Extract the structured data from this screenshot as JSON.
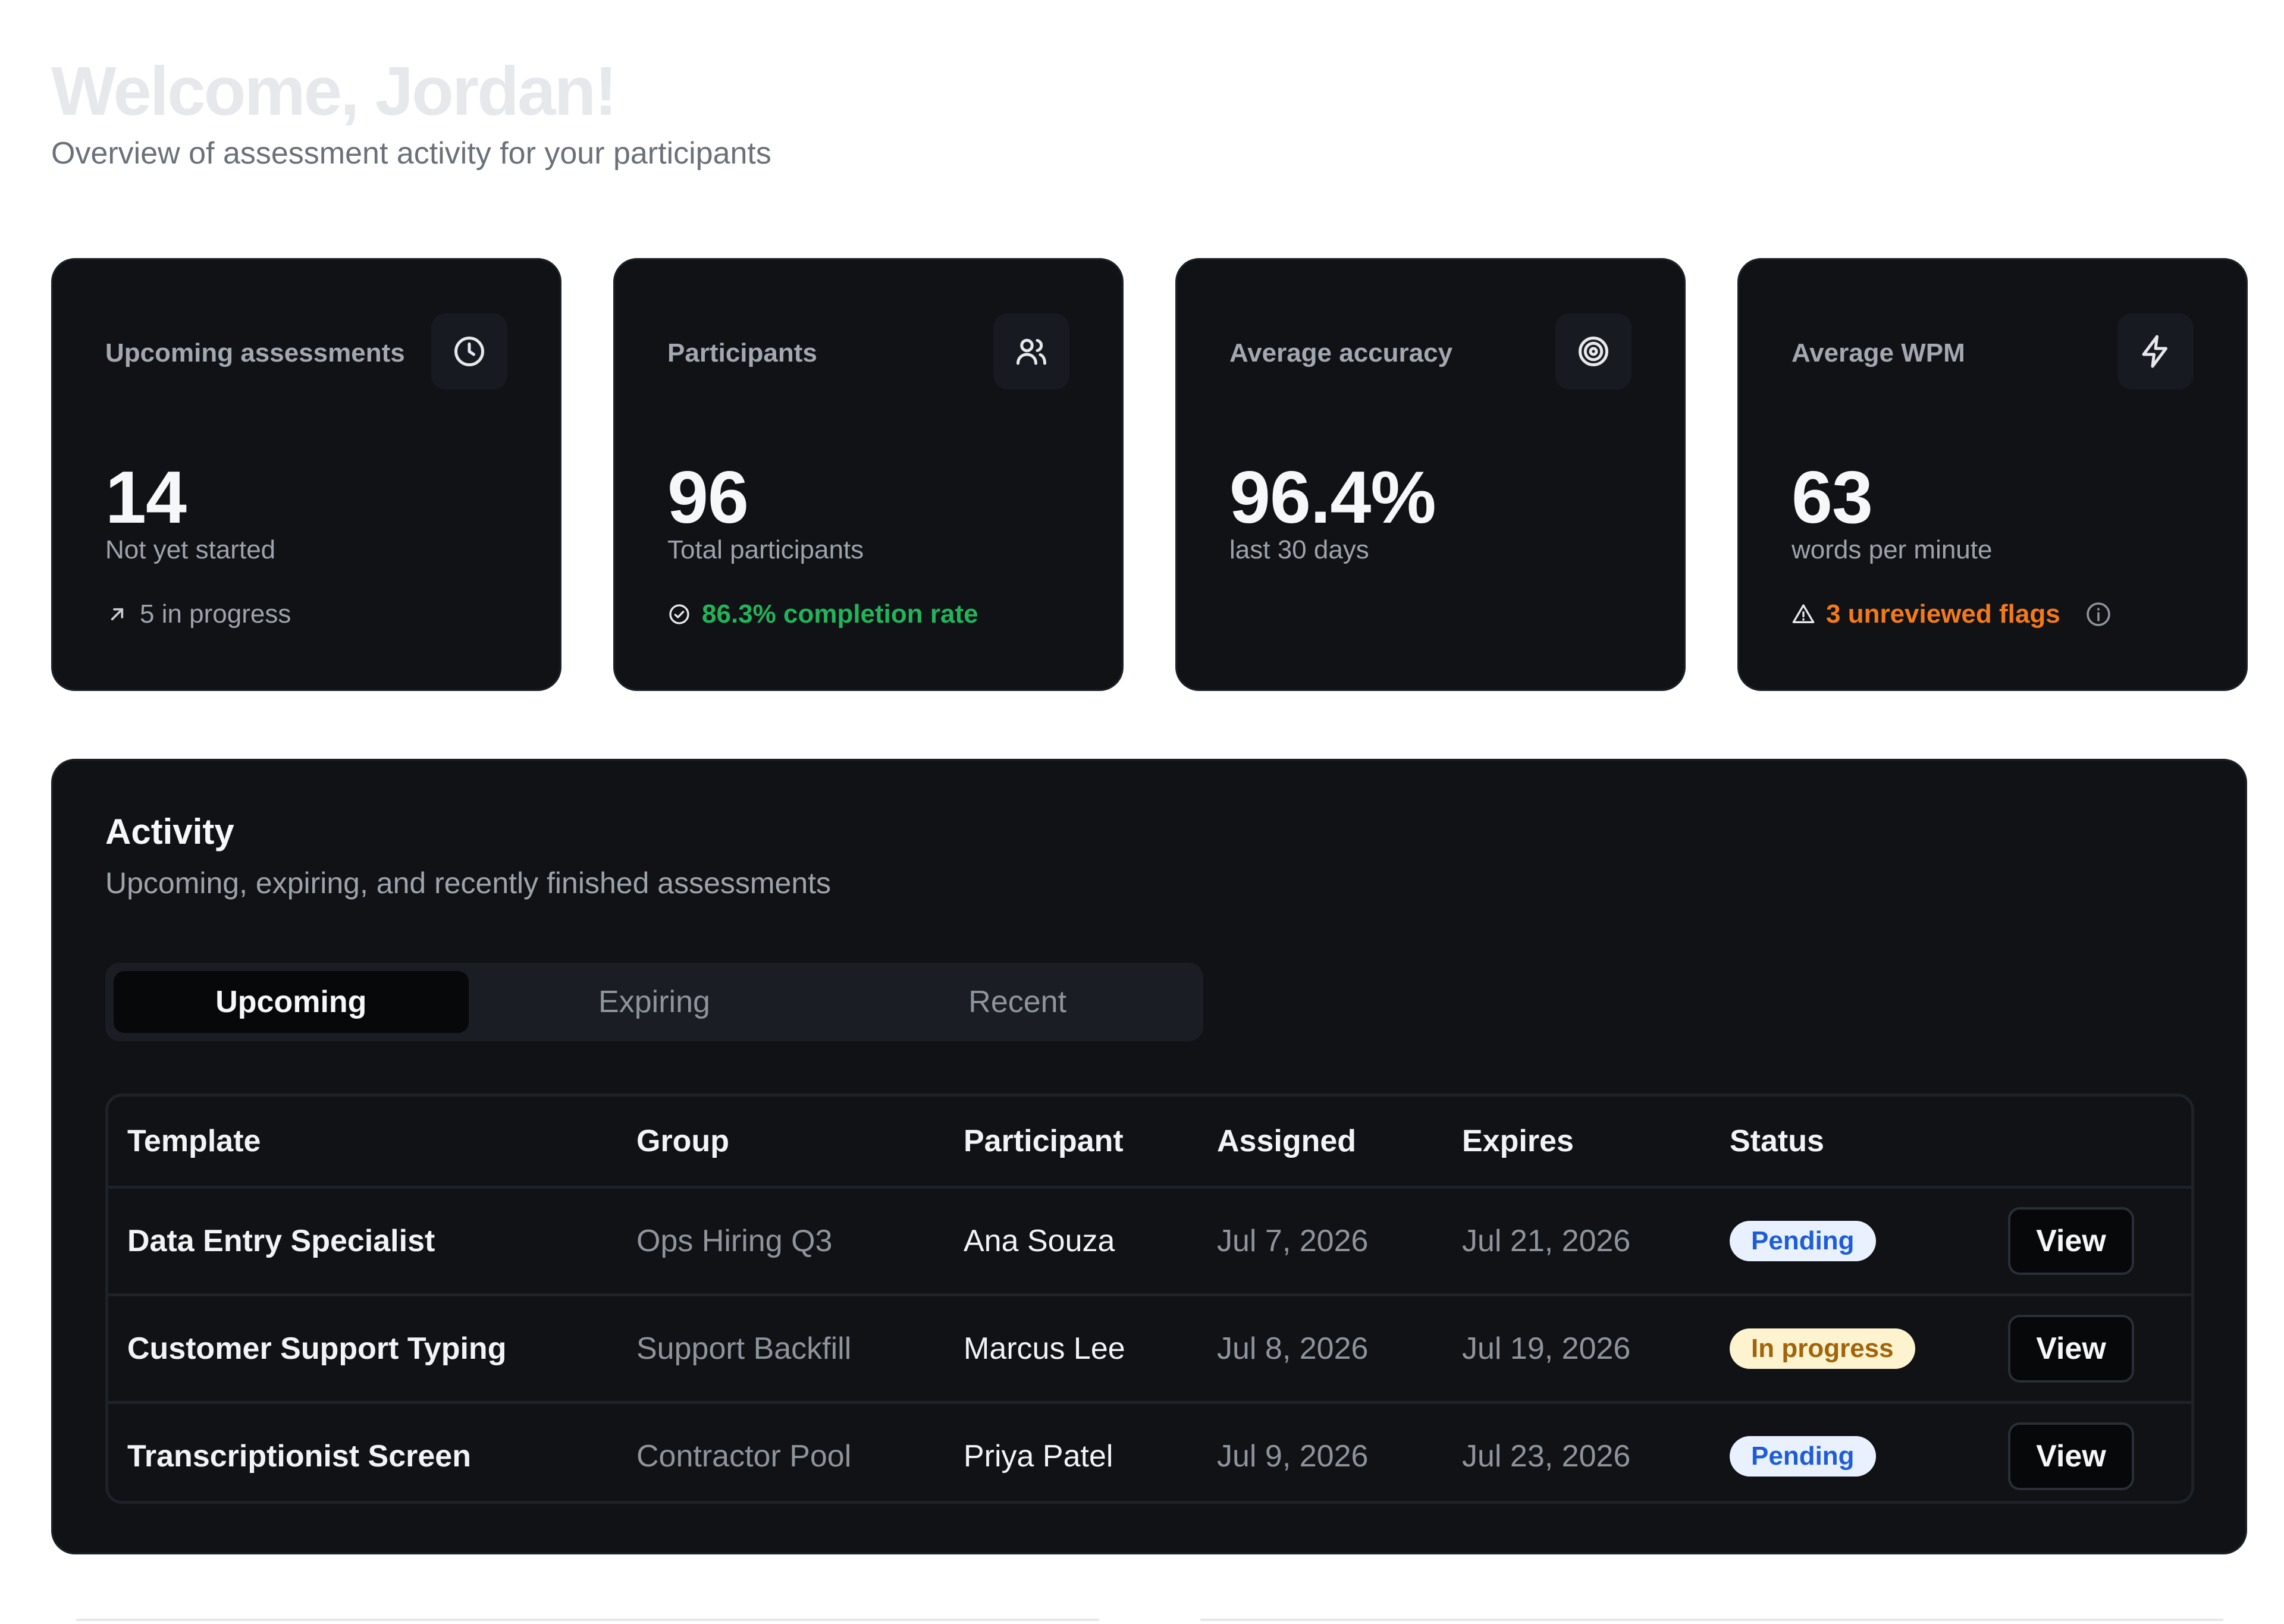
{
  "header": {
    "title": "Welcome, Jordan!",
    "subtitle": "Overview of assessment activity for your participants"
  },
  "stats": [
    {
      "label": "Upcoming assessments",
      "icon": "clock-icon",
      "value": "14",
      "caption": "Not yet started",
      "footer": "5 in progress",
      "footer_icon": "arrow-up-right-icon"
    },
    {
      "label": "Participants",
      "icon": "users-icon",
      "value": "96",
      "caption": "Total participants",
      "footer": "86.3% completion rate",
      "footer_icon": "check-circle-icon"
    },
    {
      "label": "Average accuracy",
      "icon": "target-icon",
      "value": "96.4%",
      "caption": "last 30 days"
    },
    {
      "label": "Average WPM",
      "icon": "lightning-icon",
      "value": "63",
      "caption": "words per minute",
      "footer": "3 unreviewed flags",
      "footer_icon": "warning-triangle-icon",
      "footer_trailing_icon": "info-icon"
    }
  ],
  "activity": {
    "title": "Activity",
    "subtitle": "Upcoming, expiring, and recently finished assessments",
    "tabs": [
      {
        "label": "Upcoming",
        "active": true
      },
      {
        "label": "Expiring",
        "active": false
      },
      {
        "label": "Recent",
        "active": false
      }
    ],
    "columns": [
      "Template",
      "Group",
      "Participant",
      "Assigned",
      "Expires",
      "Status"
    ],
    "rows": [
      {
        "template": "Data Entry Specialist",
        "group": "Ops Hiring Q3",
        "participant": "Ana Souza",
        "assigned": "Jul 7, 2026",
        "expires": "Jul 21, 2026",
        "status": "Pending",
        "action": "View"
      },
      {
        "template": "Customer Support Typing",
        "group": "Support Backfill",
        "participant": "Marcus Lee",
        "assigned": "Jul 8, 2026",
        "expires": "Jul 19, 2026",
        "status": "In progress",
        "action": "View"
      },
      {
        "template": "Transcriptionist Screen",
        "group": "Contractor Pool",
        "participant": "Priya Patel",
        "assigned": "Jul 9, 2026",
        "expires": "Jul 23, 2026",
        "status": "Pending",
        "action": "View"
      }
    ]
  },
  "colors": {
    "card_background": "#101216",
    "success": "#22b45a",
    "warning": "#f27a1a",
    "pending_badge": "#e9f1ff",
    "progress_badge": "#fdf3cf"
  }
}
